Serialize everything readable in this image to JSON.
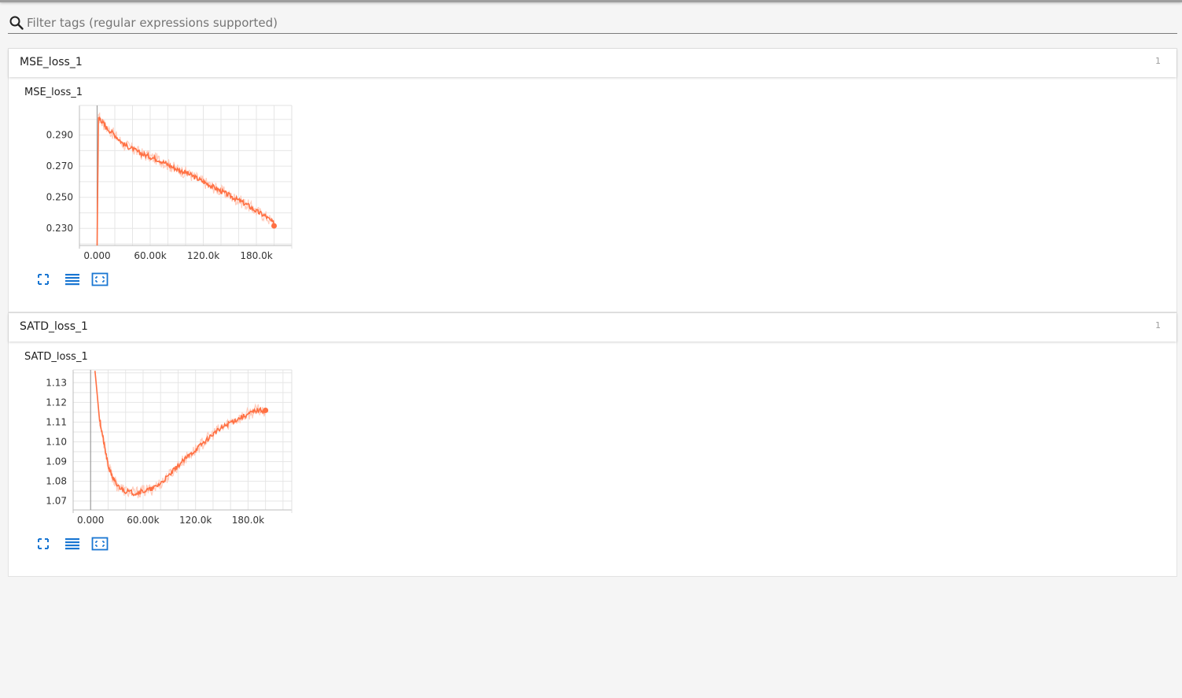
{
  "filter": {
    "placeholder": "Filter tags (regular expressions supported)",
    "value": ""
  },
  "colors": {
    "series": "#ff7043",
    "series_light": "#ffccbc",
    "accent": "#1976d2"
  },
  "categories": [
    {
      "title": "MSE_loss_1",
      "count": "1",
      "card_title": "MSE_loss_1",
      "actions": [
        "expand-icon",
        "list-icon",
        "fit-domain-icon"
      ]
    },
    {
      "title": "SATD_loss_1",
      "count": "1",
      "card_title": "SATD_loss_1",
      "actions": [
        "expand-icon",
        "list-icon",
        "fit-domain-icon"
      ]
    }
  ],
  "chart_data": [
    {
      "type": "line",
      "title": "MSE_loss_1",
      "xlabel": "",
      "ylabel": "",
      "xlim": [
        -20000,
        220000
      ],
      "ylim": [
        0.219,
        0.309
      ],
      "x_ticks": [
        0,
        60000,
        120000,
        180000
      ],
      "x_tick_labels": [
        "0.000",
        "60.00k",
        "120.0k",
        "180.0k"
      ],
      "y_ticks": [
        0.23,
        0.25,
        0.27,
        0.29
      ],
      "y_tick_labels": [
        "0.230",
        "0.250",
        "0.270",
        "0.290"
      ],
      "grid": true,
      "series": [
        {
          "x": [
            0,
            1500,
            3000,
            10000,
            20000,
            30000,
            40000,
            50000,
            60000,
            70000,
            80000,
            90000,
            100000,
            110000,
            120000,
            130000,
            140000,
            150000,
            160000,
            170000,
            180000,
            190000,
            200000
          ],
          "y": [
            0.218,
            0.3,
            0.301,
            0.295,
            0.29,
            0.284,
            0.281,
            0.278,
            0.276,
            0.274,
            0.271,
            0.268,
            0.266,
            0.263,
            0.26,
            0.257,
            0.254,
            0.251,
            0.248,
            0.245,
            0.241,
            0.238,
            0.233
          ]
        }
      ]
    },
    {
      "type": "line",
      "title": "SATD_loss_1",
      "xlabel": "",
      "ylabel": "",
      "xlim": [
        -20000,
        230000
      ],
      "ylim": [
        1.0655,
        1.1365
      ],
      "x_ticks": [
        0,
        60000,
        120000,
        180000
      ],
      "x_tick_labels": [
        "0.000",
        "60.00k",
        "120.0k",
        "180.0k"
      ],
      "y_ticks": [
        1.07,
        1.08,
        1.09,
        1.1,
        1.11,
        1.12,
        1.13
      ],
      "y_tick_labels": [
        "1.07",
        "1.08",
        "1.09",
        "1.10",
        "1.11",
        "1.12",
        "1.13"
      ],
      "grid": true,
      "series": [
        {
          "x": [
            5000,
            10000,
            15000,
            20000,
            25000,
            30000,
            40000,
            50000,
            60000,
            70000,
            80000,
            90000,
            100000,
            110000,
            120000,
            130000,
            140000,
            150000,
            160000,
            170000,
            180000,
            190000,
            200000
          ],
          "y": [
            1.136,
            1.112,
            1.1,
            1.088,
            1.082,
            1.078,
            1.075,
            1.074,
            1.075,
            1.076,
            1.079,
            1.083,
            1.088,
            1.092,
            1.096,
            1.1,
            1.104,
            1.107,
            1.11,
            1.112,
            1.114,
            1.116,
            1.116
          ]
        }
      ]
    }
  ]
}
